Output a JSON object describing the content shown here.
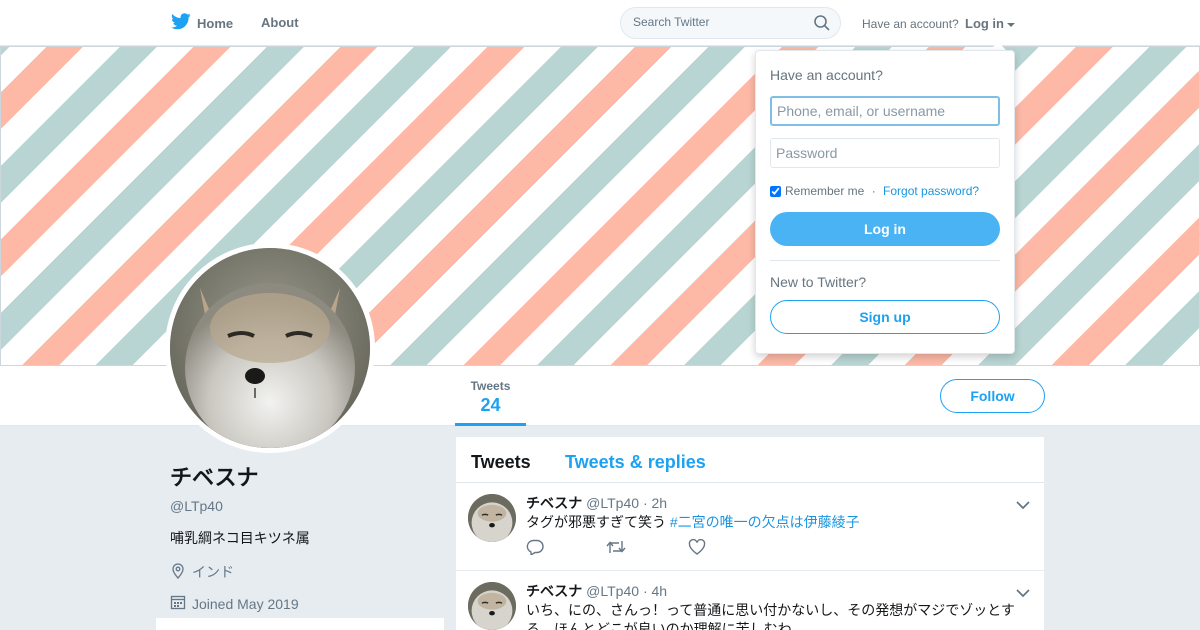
{
  "nav": {
    "home_label": "Home",
    "about_label": "About",
    "search_placeholder": "Search Twitter",
    "have_account": "Have an account?",
    "login_label": "Log in"
  },
  "profile": {
    "name": "チベスナ",
    "screen_name": "@LTp40",
    "bio": "哺乳綱ネコ目キツネ属",
    "location": "インド",
    "joined": "Joined May 2019",
    "stats": {
      "tweets_label": "Tweets",
      "tweets_value": "24"
    },
    "follow_label": "Follow"
  },
  "timeline": {
    "tabs": {
      "tweets": "Tweets",
      "replies": "Tweets & replies"
    },
    "tweets": [
      {
        "name": "チベスナ",
        "screen_name": "@LTp40",
        "separator": "·",
        "time": "2h",
        "text": "タグが邪悪すぎて笑う ",
        "hashtag": "#二宮の唯一の欠点は伊藤綾子"
      },
      {
        "name": "チベスナ",
        "screen_name": "@LTp40",
        "separator": "·",
        "time": "4h",
        "text": "いち、にの、さんっ！って普通に思い付かないし、その発想がマジでゾッとする。ほんとどこが良いのか理解に苦しむわ"
      }
    ]
  },
  "login_dropdown": {
    "title": "Have an account?",
    "username_placeholder": "Phone, email, or username",
    "password_placeholder": "Password",
    "remember_label": "Remember me",
    "separator": " · ",
    "forgot_label": "Forgot password?",
    "login_button": "Log in",
    "new_label": "New to Twitter?",
    "signup_button": "Sign up"
  },
  "colors": {
    "accent": "#1da1f2",
    "banner_stripe_teal": "#b9d5d3",
    "banner_stripe_salmon": "#fdb9a6",
    "background": "#e6ecf0"
  },
  "icons": [
    "twitter-bird-icon",
    "search-icon",
    "location-icon",
    "calendar-icon",
    "reply-icon",
    "retweet-icon",
    "like-icon",
    "chevron-down-icon"
  ]
}
